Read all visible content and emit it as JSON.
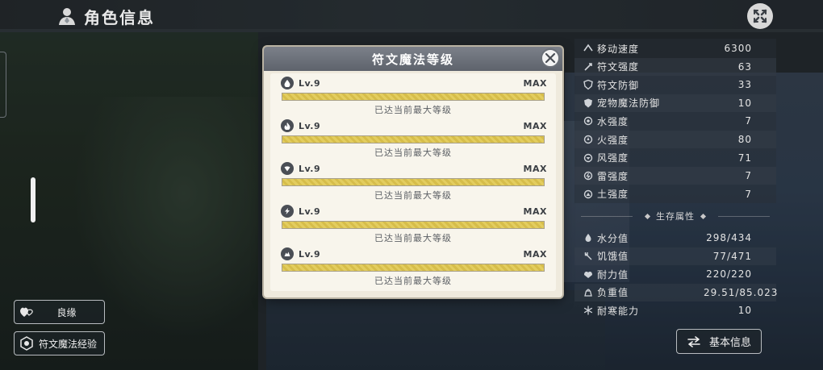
{
  "header": {
    "title": "角色信息"
  },
  "modal": {
    "title": "符文魔法等级",
    "runes": [
      {
        "icon": "water-drop-icon",
        "level": "Lv.9",
        "max": "MAX",
        "progress": 1.0,
        "note": "已达当前最大等级"
      },
      {
        "icon": "flame-icon",
        "level": "Lv.9",
        "max": "MAX",
        "progress": 1.0,
        "note": "已达当前最大等级"
      },
      {
        "icon": "wind-icon",
        "level": "Lv.9",
        "max": "MAX",
        "progress": 1.0,
        "note": "已达当前最大等级"
      },
      {
        "icon": "lightning-icon",
        "level": "Lv.9",
        "max": "MAX",
        "progress": 1.0,
        "note": "已达当前最大等级"
      },
      {
        "icon": "earth-icon",
        "level": "Lv.9",
        "max": "MAX",
        "progress": 1.0,
        "note": "已达当前最大等级"
      }
    ]
  },
  "stats": {
    "rows": [
      {
        "icon": "speed-icon",
        "label": "移动速度",
        "value": "6300"
      },
      {
        "icon": "rune-strength-icon",
        "label": "符文强度",
        "value": "63"
      },
      {
        "icon": "rune-defense-icon",
        "label": "符文防御",
        "value": "33"
      },
      {
        "icon": "pet-defense-icon",
        "label": "宠物魔法防御",
        "value": "10"
      },
      {
        "icon": "water-icon",
        "label": "水强度",
        "value": "7"
      },
      {
        "icon": "fire-icon",
        "label": "火强度",
        "value": "80"
      },
      {
        "icon": "wind-icon",
        "label": "风强度",
        "value": "71"
      },
      {
        "icon": "thunder-icon",
        "label": "雷强度",
        "value": "7"
      },
      {
        "icon": "earth-icon",
        "label": "土强度",
        "value": "7"
      }
    ],
    "survival_title": "生存属性",
    "survival": [
      {
        "icon": "water-drop-icon",
        "label": "水分值",
        "value": "298/434"
      },
      {
        "icon": "hunger-icon",
        "label": "饥饿值",
        "value": "77/471"
      },
      {
        "icon": "stamina-icon",
        "label": "耐力值",
        "value": "220/220"
      },
      {
        "icon": "weight-icon",
        "label": "负重值",
        "value": "29.51/85.023"
      },
      {
        "icon": "snowflake-icon",
        "label": "耐寒能力",
        "value": "10"
      }
    ]
  },
  "buttons": {
    "affinity": "良缘",
    "rune_exp": "符文魔法经验",
    "basic_info": "基本信息"
  },
  "colors": {
    "bar_fill": "#e3cd5f",
    "modal_bg": "#efeadd",
    "modal_header": "#6a6f78"
  }
}
